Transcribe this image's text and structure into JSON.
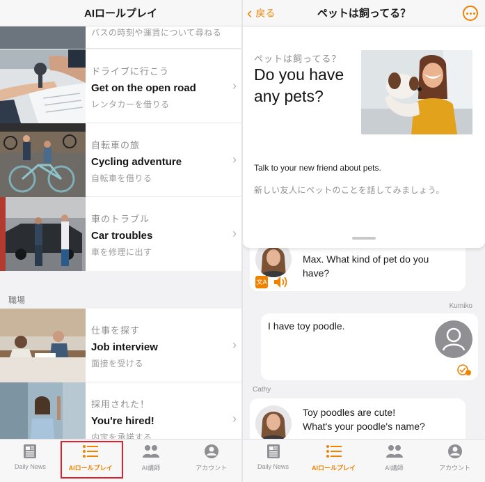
{
  "left": {
    "title": "AIロールプレイ",
    "top_partial_text": "バスの時刻や運賃について尋ねる",
    "scenarios": [
      {
        "jp_title": "ドライブに行こう",
        "en_title": "Get on the open road",
        "jp_sub": "レンタカーを借りる"
      },
      {
        "jp_title": "自転車の旅",
        "en_title": "Cycling adventure",
        "jp_sub": "自転車を借りる"
      },
      {
        "jp_title": "車のトラブル",
        "en_title": "Car troubles",
        "jp_sub": "車を修理に出す"
      },
      {
        "jp_title": "仕事を探す",
        "en_title": "Job interview",
        "jp_sub": "面接を受ける"
      },
      {
        "jp_title": "採用された！",
        "en_title": "You're hired!",
        "jp_sub": "内定を承諾する"
      }
    ],
    "section_label": "職場"
  },
  "right": {
    "back_label": "戻る",
    "title": "ペットは飼ってる？",
    "card": {
      "jp_title": "ペットは飼ってる？",
      "en_title": "Do you have any pets?",
      "desc": "Talk to your new friend about pets.",
      "desc_jp": "新しい友人にペットのことを話してみましょう。"
    },
    "messages": [
      {
        "speaker": "",
        "text1": "Max. What kind of pet do you",
        "text2": "have?"
      },
      {
        "speaker": "Kumiko",
        "text1": "I have toy poodle.",
        "text2": ""
      },
      {
        "speaker": "Cathy",
        "text1": "Toy poodles are cute!",
        "text2": "What's your poodle's name?"
      }
    ]
  },
  "tabs": [
    {
      "label": "Daily News",
      "icon": "newspaper-icon"
    },
    {
      "label": "AIロールプレイ",
      "icon": "list-icon"
    },
    {
      "label": "AI講師",
      "icon": "people-icon"
    },
    {
      "label": "アカウント",
      "icon": "person-icon"
    }
  ],
  "colors": {
    "accent": "#f08200",
    "highlight_box": "#e0202c"
  }
}
